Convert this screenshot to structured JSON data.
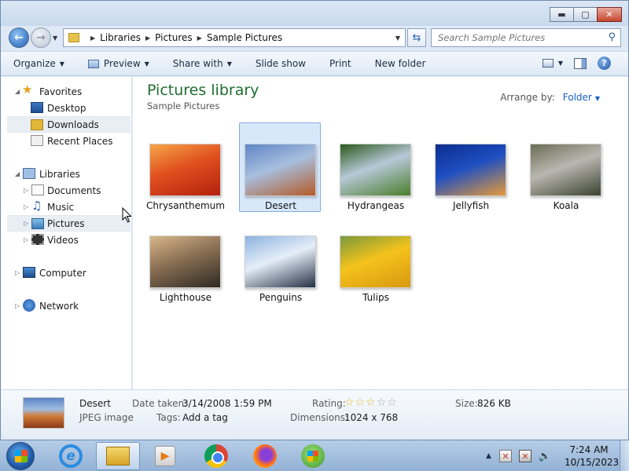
{
  "window": {
    "controls": {
      "minimize": "▬",
      "maximize": "▢",
      "close": "✕"
    }
  },
  "address": {
    "crumbs": [
      "Libraries",
      "Pictures",
      "Sample Pictures"
    ]
  },
  "search": {
    "placeholder": "Search Sample Pictures"
  },
  "toolbar": {
    "organize": "Organize",
    "preview": "Preview",
    "share_with": "Share with",
    "slide_show": "Slide show",
    "print": "Print",
    "new_folder": "New folder"
  },
  "nav": {
    "favorites": "Favorites",
    "desktop": "Desktop",
    "downloads": "Downloads",
    "recent_places": "Recent Places",
    "libraries": "Libraries",
    "documents": "Documents",
    "music": "Music",
    "pictures": "Pictures",
    "videos": "Videos",
    "computer": "Computer",
    "network": "Network"
  },
  "content": {
    "title": "Pictures library",
    "subtitle": "Sample Pictures",
    "arrange_label": "Arrange by:",
    "arrange_value": "Folder",
    "items": [
      {
        "name": "Chrysanthemum",
        "colors": [
          "#f5a54a",
          "#e0501e",
          "#b3200f"
        ]
      },
      {
        "name": "Desert",
        "colors": [
          "#5f86c6",
          "#a7bede",
          "#b45a27"
        ],
        "selected": true
      },
      {
        "name": "Hydrangeas",
        "colors": [
          "#2c5a1c",
          "#b7c8d8",
          "#4a7d2a"
        ]
      },
      {
        "name": "Jellyfish",
        "colors": [
          "#0d2d8c",
          "#1e4fc2",
          "#e59a3a"
        ]
      },
      {
        "name": "Koala",
        "colors": [
          "#6a6e55",
          "#b9b7b0",
          "#3b4230"
        ]
      },
      {
        "name": "Lighthouse",
        "colors": [
          "#d8b78a",
          "#8a6f53",
          "#2e2a24"
        ]
      },
      {
        "name": "Penguins",
        "colors": [
          "#8db3e0",
          "#e5eef8",
          "#233044"
        ]
      },
      {
        "name": "Tulips",
        "colors": [
          "#7a9a3c",
          "#f4c21c",
          "#d99910"
        ]
      }
    ]
  },
  "details": {
    "name": "Desert",
    "type": "JPEG image",
    "date_taken_label": "Date taken:",
    "date_taken": "3/14/2008 1:59 PM",
    "tags_label": "Tags:",
    "tags": "Add a tag",
    "rating_label": "Rating:",
    "rating": 3,
    "rating_max": 5,
    "dimensions_label": "Dimensions:",
    "dimensions": "1024 x 768",
    "size_label": "Size:",
    "size": "826 KB"
  },
  "taskbar": {
    "time": "7:24 AM",
    "date": "10/15/2023"
  }
}
